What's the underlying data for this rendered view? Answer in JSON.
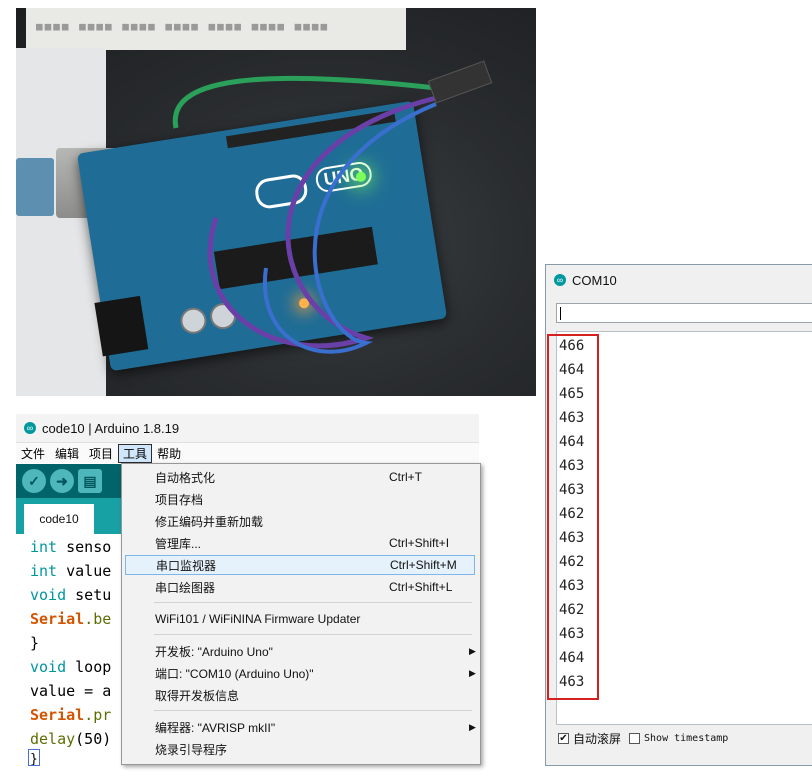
{
  "serial_monitor": {
    "title": "COM10",
    "input_value": "",
    "output_lines": [
      "466",
      "464",
      "465",
      "463",
      "464",
      "463",
      "463",
      "462",
      "463",
      "462",
      "463",
      "462",
      "463",
      "464",
      "463"
    ],
    "autoscroll_label": "自动滚屏",
    "autoscroll_checked": "✔",
    "timestamp_label": "Show timestamp"
  },
  "ide": {
    "title": "code10 | Arduino 1.8.19",
    "menu": {
      "file": "文件",
      "edit": "编辑",
      "sketch": "项目",
      "tools": "工具",
      "help": "帮助"
    },
    "tab": "code10",
    "code": {
      "line1_type": "int",
      "line1_rest": " senso",
      "line2_type": "int",
      "line2_rest": " value",
      "line3_type": "void",
      "line3_rest": " setu",
      "line4_obj": "Serial",
      "line4_rest": ".be",
      "line5": "}",
      "line6_type": "void",
      "line6_rest": " loop",
      "line7": "value = a",
      "line8_obj": "Serial",
      "line8_rest": ".pr",
      "line9_fn": "delay",
      "line9_rest": "(50)",
      "line10": "}"
    }
  },
  "tools_menu": {
    "items": [
      {
        "label": "自动格式化",
        "shortcut": "Ctrl+T"
      },
      {
        "label": "项目存档",
        "shortcut": ""
      },
      {
        "label": "修正编码并重新加载",
        "shortcut": ""
      },
      {
        "label": "管理库...",
        "shortcut": "Ctrl+Shift+I"
      },
      {
        "label": "串口监视器",
        "shortcut": "Ctrl+Shift+M"
      },
      {
        "label": "串口绘图器",
        "shortcut": "Ctrl+Shift+L"
      },
      {
        "label": "WiFi101 / WiFiNINA Firmware Updater",
        "shortcut": ""
      },
      {
        "label": "开发板: \"Arduino Uno\"",
        "shortcut": "",
        "arrow": "▶"
      },
      {
        "label": "端口: \"COM10 (Arduino Uno)\"",
        "shortcut": "",
        "arrow": "▶"
      },
      {
        "label": "取得开发板信息",
        "shortcut": ""
      },
      {
        "label": "编程器: \"AVRISP mkII\"",
        "shortcut": "",
        "arrow": "▶"
      },
      {
        "label": "烧录引导程序",
        "shortcut": ""
      }
    ]
  },
  "photo": {
    "board_label": "UNO"
  },
  "colors": {
    "arduino_teal": "#00979d",
    "toolbar_dark": "#006468",
    "highlight_red": "#d61f1f"
  }
}
